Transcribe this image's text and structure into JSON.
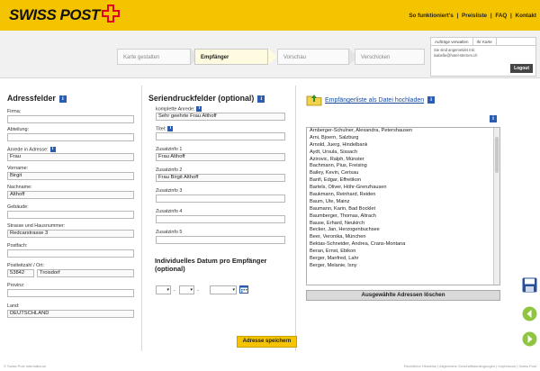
{
  "brand": {
    "logo_text": "SWISS POST",
    "color": "#f5c400"
  },
  "topnav": {
    "how": "So funktioniert's",
    "sep1": "|",
    "prices": "Preisliste",
    "sep2": "|",
    "faq": "FAQ",
    "sep3": "|",
    "contact": "Kontakt"
  },
  "steps": [
    "Karte gestalten",
    "Empfänger",
    "Vorschau",
    "Verschicken"
  ],
  "user_panel": {
    "tab_orders": "Aufträge verwalten",
    "tab_cart": "Ihr Karte",
    "status": "Sie sind angemeldet mit:",
    "email": "isabelle@hotel-sternen.ch",
    "logout": "Logout"
  },
  "address_fields": {
    "title": "Adressfelder",
    "company": {
      "label": "Firma:",
      "value": ""
    },
    "department": {
      "label": "Abteilung:",
      "value": ""
    },
    "salutation": {
      "label": "Anrede in Adresse:",
      "value": "Frau"
    },
    "firstname": {
      "label": "Vorname:",
      "value": "Birgit"
    },
    "lastname": {
      "label": "Nachname:",
      "value": "Althoff"
    },
    "building": {
      "label": "Gebäude:",
      "value": ""
    },
    "street": {
      "label": "Strasse und Hausnummer:",
      "value": "Redcarstrasse 3"
    },
    "pobox": {
      "label": "Postfach:",
      "value": ""
    },
    "zipcity": {
      "label": "Postleitzahl / Ort:",
      "zip": "53842",
      "city": "Troisdorf"
    },
    "province": {
      "label": "Provinz:",
      "value": ""
    },
    "country": {
      "label": "Land:",
      "value": "DEUTSCHLAND"
    }
  },
  "merge_fields": {
    "title": "Seriendruckfelder (optional)",
    "full_salutation": {
      "label": "komplette Anrede:",
      "value": "Sehr geehrte Frau Althoff"
    },
    "title_field": {
      "label": "Titel:",
      "value": ""
    },
    "extra1": {
      "label": "Zusatzinfo 1",
      "value": "Frau Althoff"
    },
    "extra2": {
      "label": "Zusatzinfo 2",
      "value": "Frau Birgit Althoff"
    },
    "extra3": {
      "label": "Zusatzinfo 3",
      "value": ""
    },
    "extra4": {
      "label": "Zusatzinfo 4",
      "value": ""
    },
    "extra5": {
      "label": "Zusatzinfo 5",
      "value": ""
    },
    "date_title": "Individuelles Datum pro Empfänger (optional)",
    "date_dot": "."
  },
  "address_list": {
    "upload_label": "Empfängerliste als Datei hochladen",
    "items": [
      "Arnberger-Schulner, Alexandra, Petershausen",
      "Arni, Bjoern, Salzburg",
      "Arnold, Juerg, Hindelbank",
      "Aydt, Ursula, Sissach",
      "Azirovic, Ralph, Münster",
      "Bachmann, Pius, Freising",
      "Bailey, Kevin, Cerisau",
      "Banfi, Edgar, Effretikon",
      "Bartels, Oliver, Höhr-Grenzhausen",
      "Baukmann, Reinhard, Reiden",
      "Baum, Ute, Mainz",
      "Baumann, Karin, Bad Bocklet",
      "Baumberger, Thomas, Altrach",
      "Bause, Erhard, Neukirch",
      "Becker, Jan, Herzogenbuchsee",
      "Beer, Veronika, München",
      "Bektas-Schneider, Andrea, Crans-Montana",
      "Beran, Ernst, Ebikon",
      "Berger, Manfred, Lahr",
      "Berger, Melanie, Isny"
    ],
    "delete_label": "Ausgewählte Adressen löschen"
  },
  "save_label": "Adresse speichern",
  "footer": {
    "copyright": "© Swiss Post International",
    "links": "Rechtliche Hinweise   |   Allgemeine Geschäftsbedingungen   |   Impressum   |   Swiss Post"
  }
}
